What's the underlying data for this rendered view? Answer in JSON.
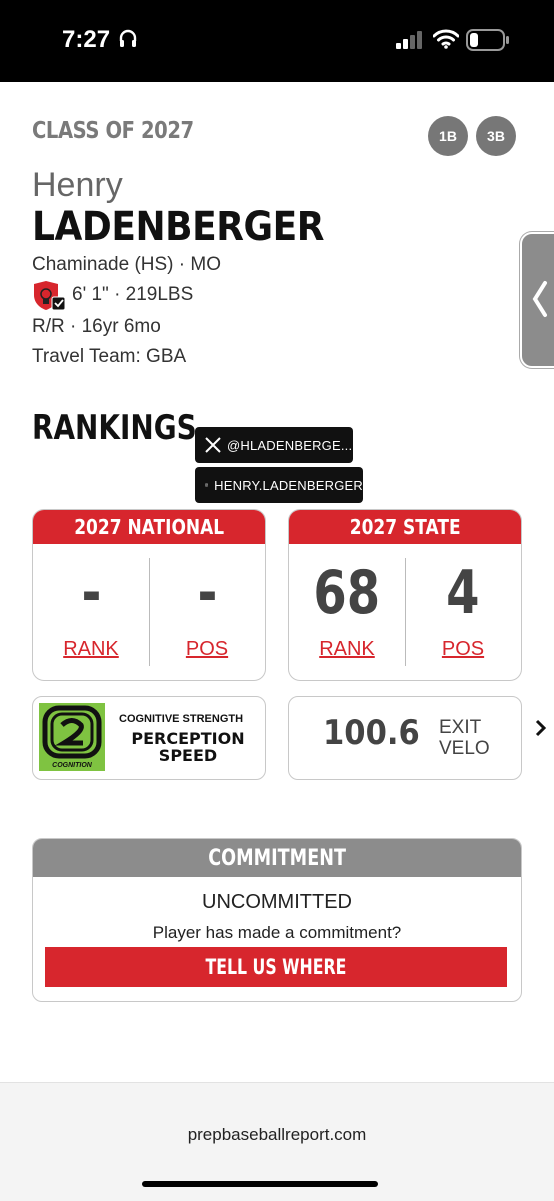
{
  "status_bar": {
    "time": "7:27",
    "icons": [
      "headphones-icon",
      "signal-icon",
      "wifi-icon",
      "battery-icon"
    ]
  },
  "player": {
    "class_of": "CLASS OF 2027",
    "positions": [
      "1B",
      "3B"
    ],
    "first_name": "Henry",
    "last_name": "LADENBERGER",
    "school": "Chaminade (HS) · MO",
    "size": "6' 1\" · 219LBS",
    "bats_throws_age": "R/R · 16yr 6mo",
    "travel_team": "Travel Team: GBA"
  },
  "rankings": {
    "heading": "RANKINGS",
    "socials": {
      "x_handle": "@HLADENBERGE...",
      "instagram": "HENRY.LADENBERGER"
    },
    "national": {
      "title": "2027 NATIONAL",
      "rank": "-",
      "pos": "-",
      "rank_label": "RANK",
      "pos_label": "POS"
    },
    "state": {
      "title": "2027 STATE",
      "rank": "68",
      "pos": "4",
      "rank_label": "RANK",
      "pos_label": "POS"
    }
  },
  "cognitive": {
    "logo_text": "COGNITION",
    "subtitle": "COGNITIVE STRENGTH",
    "line1": "PERCEPTION",
    "line2": "SPEED"
  },
  "exit_velo": {
    "value": "100.6",
    "label_line1": "EXIT",
    "label_line2": "VELO"
  },
  "commitment": {
    "title": "COMMITMENT",
    "status": "UNCOMMITTED",
    "question": "Player has made a commitment?",
    "button": "TELL US WHERE"
  },
  "browser": {
    "url": "prepbaseballreport.com"
  },
  "colors": {
    "accent_red": "#d7262d",
    "gray_header": "#8c8c8c",
    "cognition_green": "#7fc341"
  }
}
